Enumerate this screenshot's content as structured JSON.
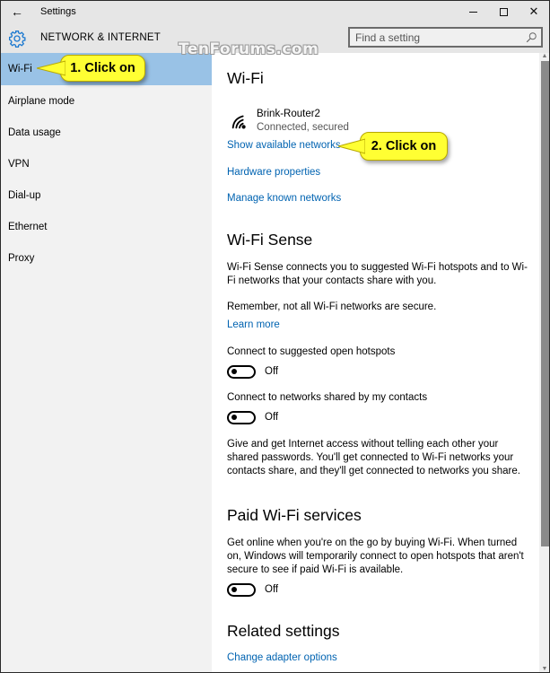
{
  "window": {
    "title": "Settings",
    "back_icon": "←",
    "controls": {
      "minimize": "minimize-icon",
      "maximize": "maximize-icon",
      "close_glyph": "✕"
    }
  },
  "header": {
    "section_title": "NETWORK & INTERNET",
    "icon": "gear-icon",
    "search": {
      "placeholder": "Find a setting",
      "value": ""
    }
  },
  "watermark": "TenForums.com",
  "sidebar": {
    "items": [
      {
        "label": "Wi-Fi",
        "selected": true
      },
      {
        "label": "Airplane mode",
        "selected": false
      },
      {
        "label": "Data usage",
        "selected": false
      },
      {
        "label": "VPN",
        "selected": false
      },
      {
        "label": "Dial-up",
        "selected": false
      },
      {
        "label": "Ethernet",
        "selected": false
      },
      {
        "label": "Proxy",
        "selected": false
      }
    ]
  },
  "content": {
    "wifi": {
      "title": "Wi-Fi",
      "network": {
        "name": "Brink-Router2",
        "status": "Connected, secured",
        "icon": "wifi-signal-icon"
      },
      "links": {
        "show_networks": "Show available networks",
        "hardware": "Hardware properties",
        "manage_known": "Manage known networks"
      }
    },
    "wifi_sense": {
      "title": "Wi-Fi Sense",
      "description": "Wi-Fi Sense connects you to suggested Wi-Fi hotspots and to Wi-Fi networks that your contacts share with you.",
      "remember": "Remember, not all Wi-Fi networks are secure.",
      "learn_more": "Learn more",
      "toggle_open_hotspots": {
        "label": "Connect to suggested open hotspots",
        "state": "Off",
        "on": false
      },
      "toggle_contacts": {
        "label": "Connect to networks shared by my contacts",
        "state": "Off",
        "on": false
      },
      "sharing_text": "Give and get Internet access without telling each other your shared passwords. You'll get connected to Wi-Fi networks your contacts share, and they'll get connected to networks you share."
    },
    "paid_wifi": {
      "title": "Paid Wi-Fi services",
      "description": "Get online when you're on the go by buying Wi-Fi. When turned on, Windows will temporarily connect to open hotspots that aren't secure to see if paid Wi-Fi is available.",
      "toggle": {
        "state": "Off",
        "on": false
      }
    },
    "related": {
      "title": "Related settings",
      "change_adapter": "Change adapter options"
    }
  },
  "callouts": {
    "step1": "1. Click on",
    "step2": "2. Click on",
    "color": "#ffff33"
  },
  "colors": {
    "accent_link": "#0063b1",
    "selected_nav": "#99c2e6",
    "gear_icon": "#1e7ad0"
  }
}
